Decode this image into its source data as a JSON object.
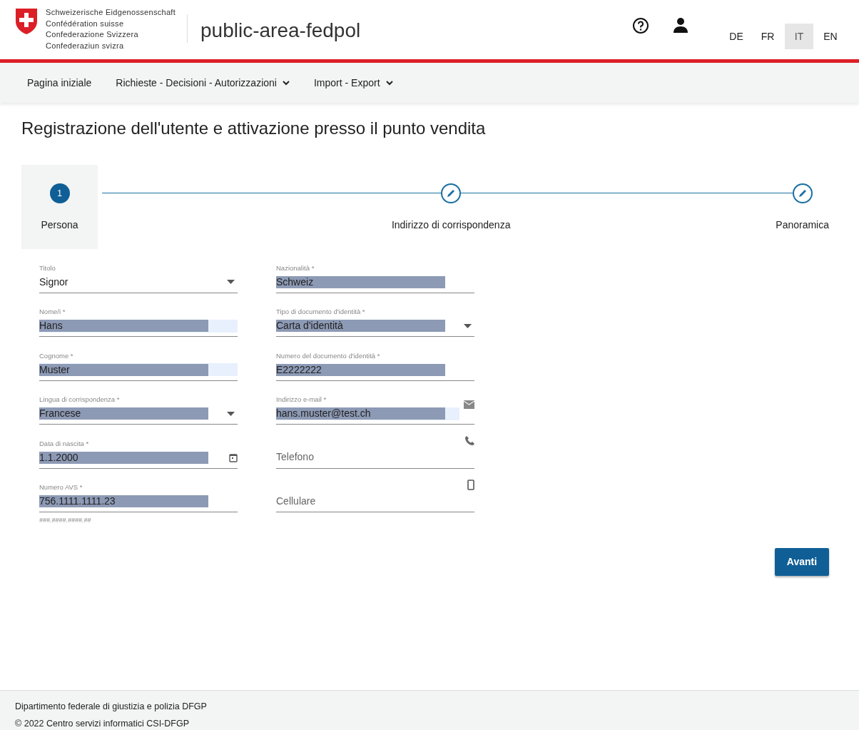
{
  "header": {
    "confederation_lines": [
      "Schweizerische Eidgenossenschaft",
      "Confédération suisse",
      "Confederazione Svizzera",
      "Confederaziun svizra"
    ],
    "app_title": "public-area-fedpol",
    "languages": [
      {
        "label": "DE",
        "selected": false
      },
      {
        "label": "FR",
        "selected": false
      },
      {
        "label": "IT",
        "selected": true
      },
      {
        "label": "EN",
        "selected": false
      }
    ]
  },
  "nav": [
    {
      "label": "Pagina iniziale",
      "dropdown": false
    },
    {
      "label": "Richieste - Decisioni - Autorizzazioni",
      "dropdown": true
    },
    {
      "label": "Import - Export",
      "dropdown": true
    }
  ],
  "page_title": "Registrazione dell'utente e attivazione presso il punto vendita",
  "stepper": [
    {
      "label": "Persona",
      "marker": "1",
      "selected": true
    },
    {
      "label": "Indirizzo di corrispondenza",
      "selected": false
    },
    {
      "label": "Panoramica",
      "selected": false
    }
  ],
  "form": {
    "columns": [
      [
        {
          "kind": "select",
          "label": "Titolo",
          "value": "Signor",
          "highlighted": false,
          "autofilled": false
        },
        {
          "kind": "text",
          "label": "Nome/i *",
          "value": "Hans",
          "highlighted": true,
          "autofilled": true
        },
        {
          "kind": "text",
          "label": "Cognome *",
          "value": "Muster",
          "highlighted": true,
          "autofilled": true
        },
        {
          "kind": "select",
          "label": "Lingua di corrispondenza *",
          "value": "Francese",
          "highlighted": true,
          "autofilled": false
        },
        {
          "kind": "date",
          "label": "Data di nascita *",
          "value": "1.1.2000",
          "highlighted": true,
          "autofilled": false
        },
        {
          "kind": "text",
          "label": "Numero AVS *",
          "value": "756.1111.1111.23",
          "highlighted": true,
          "autofilled": false,
          "hint": "###.####.####.##"
        }
      ],
      [
        {
          "kind": "text",
          "label": "Nazionalità *",
          "value": "Schweiz",
          "highlighted": true,
          "autofilled": false
        },
        {
          "kind": "select",
          "label": "Tipo di documento d'identità *",
          "value": "Carta d'identità",
          "highlighted": true,
          "autofilled": false
        },
        {
          "kind": "text",
          "label": "Numero del documento d'identità *",
          "value": "E2222222",
          "highlighted": true,
          "autofilled": false
        },
        {
          "kind": "email",
          "label": "Indirizzo e-mail *",
          "value": "hans.muster@test.ch",
          "highlighted": true,
          "autofilled": true
        },
        {
          "kind": "phone",
          "placeholder": "Telefono"
        },
        {
          "kind": "mobile",
          "placeholder": "Cellulare"
        }
      ]
    ]
  },
  "next_button": "Avanti",
  "footer": [
    "Dipartimento federale di giustizia e polizia DFGP",
    "© 2022 Centro servizi informatici CSI-DFGP"
  ]
}
